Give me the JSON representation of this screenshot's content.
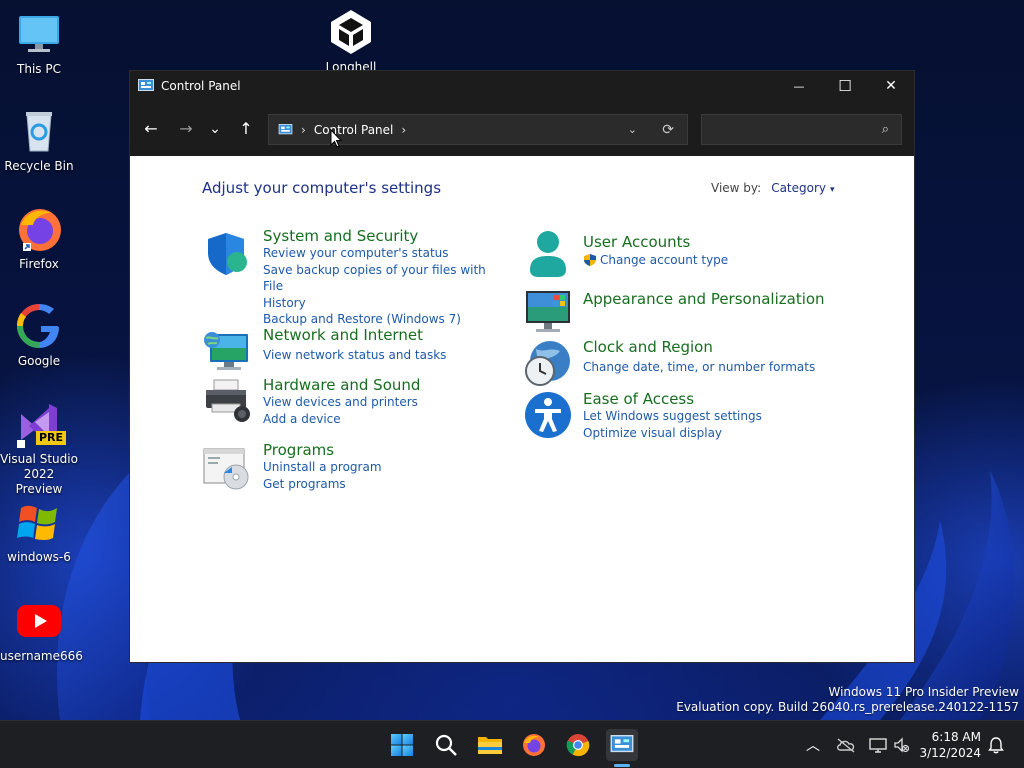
{
  "desktop": {
    "icons": [
      {
        "label": "This PC"
      },
      {
        "label": "Recycle Bin"
      },
      {
        "label": "Firefox"
      },
      {
        "label": "Google"
      },
      {
        "label": "Visual Studio 2022 Preview",
        "badge": "PRE"
      },
      {
        "label": "windows-6"
      },
      {
        "label": "username666"
      },
      {
        "label": "Longhell"
      }
    ],
    "watermark": {
      "line1": "Windows 11 Pro Insider Preview",
      "line2": "Evaluation copy. Build 26040.rs_prerelease.240122-1157"
    }
  },
  "window": {
    "title": "Control Panel",
    "controls": {
      "minimize": "—",
      "maximize": "☐",
      "close": "✕"
    },
    "nav": {
      "back": "←",
      "forward": "→",
      "recent": "⌄",
      "up": "↑"
    },
    "address": {
      "separator": "›",
      "crumb": "Control Panel",
      "trail_separator": "›",
      "dropdown": "⌄",
      "refresh": "⟳"
    },
    "search": {
      "placeholder": "",
      "icon": "⌕"
    },
    "content": {
      "heading": "Adjust your computer's settings",
      "view_by_label": "View by:",
      "view_by_value": "Category",
      "view_by_caret": "▾",
      "categories_left": [
        {
          "title": "System and Security",
          "icon": "shield-icon",
          "links": [
            "Review your computer's status",
            "Save backup copies of your files with File",
            "History",
            "Backup and Restore (Windows 7)"
          ]
        },
        {
          "title": "Network and Internet",
          "icon": "network-globe-icon",
          "links": [
            "View network status and tasks"
          ]
        },
        {
          "title": "Hardware and Sound",
          "icon": "printer-icon",
          "links": [
            "View devices and printers",
            "Add a device"
          ]
        },
        {
          "title": "Programs",
          "icon": "programs-disc-icon",
          "links": [
            "Uninstall a program",
            "Get programs"
          ]
        }
      ],
      "categories_right": [
        {
          "title": "User Accounts",
          "icon": "user-icon",
          "links": [
            "Change account type"
          ]
        },
        {
          "title": "Appearance and Personalization",
          "icon": "monitor-palette-icon",
          "links": []
        },
        {
          "title": "Clock and Region",
          "icon": "clock-globe-icon",
          "links": [
            "Change date, time, or number formats"
          ]
        },
        {
          "title": "Ease of Access",
          "icon": "accessibility-icon",
          "links": [
            "Let Windows suggest settings",
            "Optimize visual display"
          ]
        }
      ]
    }
  },
  "taskbar": {
    "apps": [
      "start-icon",
      "search-icon",
      "file-explorer-icon",
      "firefox-icon",
      "chrome-icon",
      "control-panel-icon"
    ],
    "tray": {
      "chevron": "︿"
    },
    "clock": {
      "time": "6:18 AM",
      "date": "3/12/2024"
    }
  },
  "colors": {
    "title_bar": "#1c1c1c",
    "category_title": "#176e1f",
    "link": "#1e5aa8",
    "heading": "#1e3287",
    "taskbar": "#1e1f22"
  }
}
